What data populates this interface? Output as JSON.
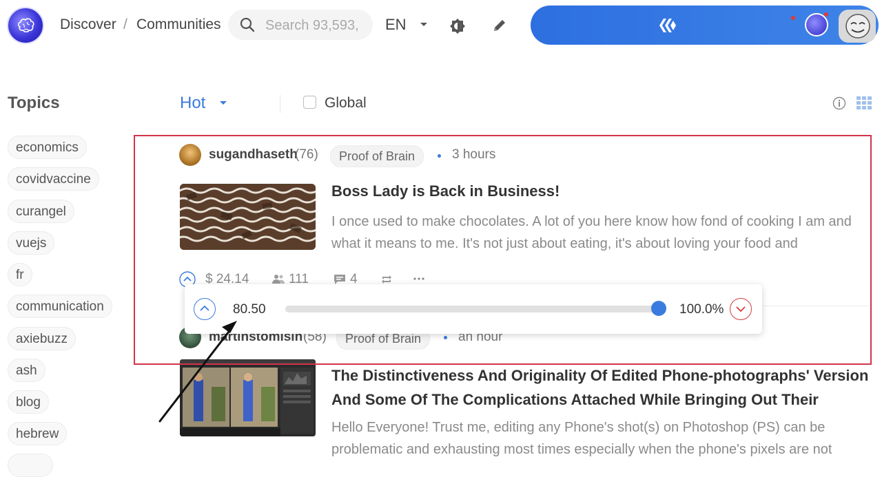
{
  "header": {
    "breadcrumb": [
      "Discover",
      "Communities"
    ],
    "breadcrumb_separator": "/",
    "search_placeholder": "Search 93,593,",
    "language": "EN"
  },
  "sort": {
    "selected": "Hot",
    "global_label": "Global",
    "global_checked": false
  },
  "topics": {
    "title": "Topics",
    "items": [
      "economics",
      "covidvaccine",
      "curangel",
      "vuejs",
      "fr",
      "communication",
      "axiebuzz",
      "ash",
      "blog",
      "hebrew"
    ]
  },
  "posts": [
    {
      "author": "sugandhaseth",
      "reputation": "(76)",
      "community": "Proof of Brain",
      "time": "3 hours",
      "title": "Boss Lady is Back in Business!",
      "excerpt": "I once used to make chocolates. A lot of you here know how fond of cooking I am and what it means to me. It's not just about eating, it's about loving your food and",
      "payout": "$ 24.14",
      "votes": "111",
      "comments": "4"
    },
    {
      "author": "martinstomisin",
      "reputation": "(58)",
      "community": "Proof of Brain",
      "time": "an hour",
      "title": "The Distinctiveness And Originality Of Edited Phone-photographs' Version And Some Of The Complications Attached While Bringing Out Their",
      "excerpt": "Hello Everyone! Trust me, editing any Phone's shot(s) on Photoshop (PS) can be problematic and exhausting most times especially when the phone's pixels are not"
    }
  ],
  "vote_popup": {
    "value": "80.50",
    "percent": "100.0%",
    "slider_fraction": 1.0
  },
  "colors": {
    "accent": "#3a7be0",
    "header_bar": "#2d6fe0",
    "highlight": "#d2334a",
    "downvote": "#d23c3c"
  },
  "icons": [
    "search-icon",
    "caret-down-icon",
    "theme-toggle-icon",
    "pencil-icon",
    "hive-logo-icon",
    "info-icon",
    "grid-view-icon",
    "upvote-icon",
    "users-icon",
    "comment-icon",
    "reblog-icon",
    "more-icon",
    "downvote-icon"
  ]
}
